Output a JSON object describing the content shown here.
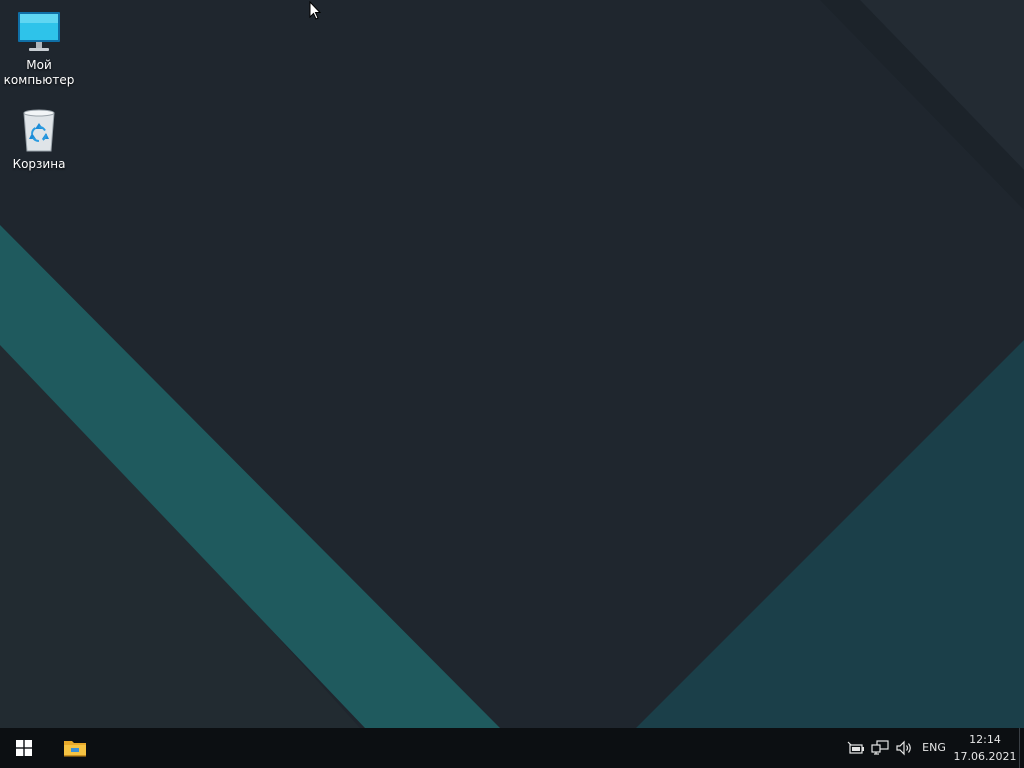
{
  "desktop": {
    "icons": [
      {
        "label": "Мой\nкомпьютер",
        "icon": "monitor-icon"
      },
      {
        "label": "Корзина",
        "icon": "recycle-bin-icon"
      }
    ],
    "colors": {
      "background": "#1f262e",
      "stripe_teal": "#1f5a5e",
      "corner_teal": "#1b3f49"
    }
  },
  "taskbar": {
    "start_icon": "windows-logo-icon",
    "pinned": [
      {
        "icon": "file-explorer-icon"
      }
    ],
    "tray": {
      "icons": [
        "power-icon",
        "network-icon",
        "volume-icon"
      ],
      "language": "ENG",
      "time": "12:14",
      "date": "17.06.2021"
    }
  }
}
